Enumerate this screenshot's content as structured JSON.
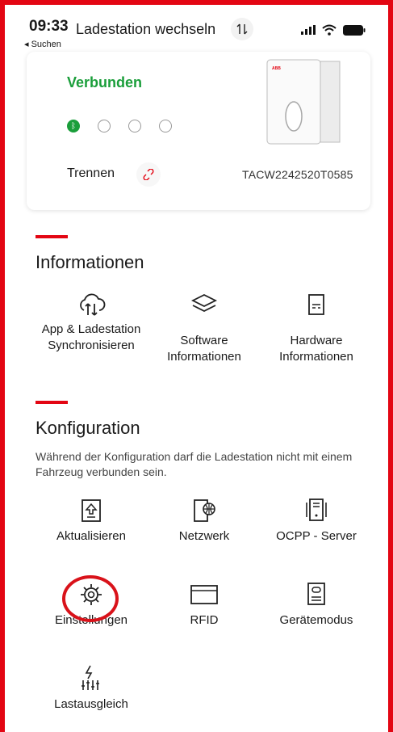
{
  "status_bar": {
    "time": "09:33",
    "back_label": "◂ Suchen"
  },
  "header": {
    "title": "Ladestation wechseln"
  },
  "card": {
    "state": "Verbunden",
    "disconnect_label": "Trennen",
    "serial": "TACW2242520T0585"
  },
  "informationen": {
    "title": "Informationen",
    "items": [
      {
        "label": "App & Ladestation Synchronisieren",
        "icon": "cloud-sync-icon"
      },
      {
        "label": "Software Informationen",
        "icon": "layers-icon"
      },
      {
        "label": "Hardware Informationen",
        "icon": "hardware-info-icon"
      }
    ]
  },
  "konfiguration": {
    "title": "Konfiguration",
    "note": "Während der Konfiguration darf die Ladestation nicht mit einem Fahrzeug verbunden sein.",
    "items": [
      {
        "label": "Aktualisieren",
        "icon": "update-icon"
      },
      {
        "label": "Netzwerk",
        "icon": "network-icon"
      },
      {
        "label": "OCPP - Server",
        "icon": "ocpp-server-icon"
      },
      {
        "label": "Einstellungen",
        "icon": "settings-icon"
      },
      {
        "label": "RFID",
        "icon": "rfid-card-icon"
      },
      {
        "label": "Gerätemodus",
        "icon": "device-mode-icon"
      },
      {
        "label": "Lastausgleich",
        "icon": "load-balancing-icon"
      }
    ]
  },
  "colors": {
    "accent": "#e30613",
    "connected": "#1a9e3a"
  }
}
